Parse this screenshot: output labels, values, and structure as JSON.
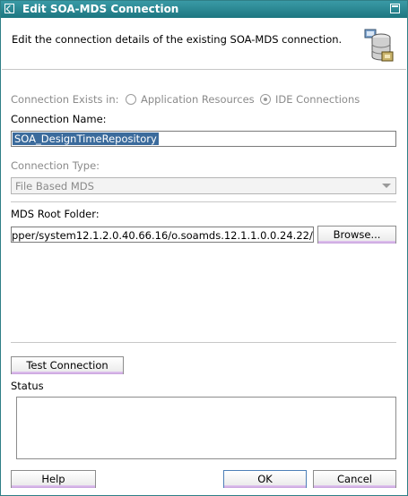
{
  "window": {
    "title": "Edit SOA-MDS Connection"
  },
  "header": {
    "description": "Edit the connection details of the existing SOA-MDS connection."
  },
  "connection_exists": {
    "label": "Connection Exists in:",
    "options": [
      {
        "label": "Application Resources",
        "checked": false
      },
      {
        "label": "IDE Connections",
        "checked": true
      }
    ]
  },
  "connection_name": {
    "label": "Connection Name:",
    "value": "SOA_DesignTimeRepository"
  },
  "connection_type": {
    "label": "Connection Type:",
    "value": "File Based MDS"
  },
  "mds_root": {
    "label": "MDS Root Folder:",
    "value": "pper/system12.1.2.0.40.66.16/o.soamds.12.1.1.0.0.24.22/",
    "browse_label": "Browse..."
  },
  "test_connection_label": "Test Connection",
  "status": {
    "label": "Status",
    "value": ""
  },
  "footer": {
    "help_label": "Help",
    "ok_label": "OK",
    "cancel_label": "Cancel"
  }
}
